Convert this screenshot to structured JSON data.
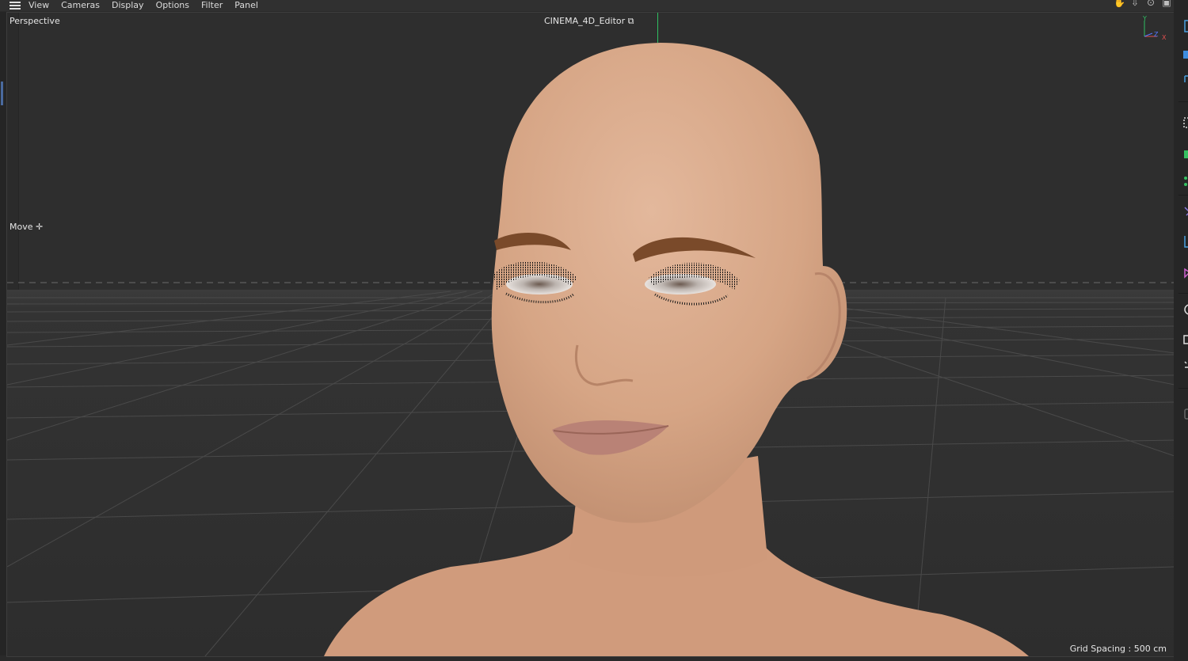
{
  "menubar": {
    "items": [
      "View",
      "Cameras",
      "Display",
      "Options",
      "Filter",
      "Panel"
    ],
    "nav_icons": [
      "pan-hand-icon",
      "dolly-arrow-icon",
      "orbit-icon",
      "maximize-view-icon"
    ]
  },
  "viewport": {
    "camera_label": "Perspective",
    "renderer_label": "CINEMA_4D_Editor",
    "tool_label": "Move",
    "grid_spacing": "Grid Spacing : 500 cm",
    "axis_labels": {
      "y": "Y",
      "z": "Z",
      "x": "X"
    }
  },
  "colors": {
    "viewport_bg": "#2e2e2e",
    "grid_line": "#4a4a4a",
    "skin": "#d8a98a",
    "brow": "#7a4a2a",
    "lips": "#b98276",
    "y_axis": "#2fbf62",
    "x_axis": "#e05050",
    "z_axis": "#5577ff"
  },
  "right_tools": [
    "select-box-icon",
    "cube-icon",
    "bend-icon",
    "snap-icon",
    "green-object-icon",
    "points-icon",
    "pen-icon",
    "axis-icon",
    "polygon-icon",
    "globe-icon",
    "workplane-icon",
    "transform-icon",
    "lock-icon"
  ]
}
